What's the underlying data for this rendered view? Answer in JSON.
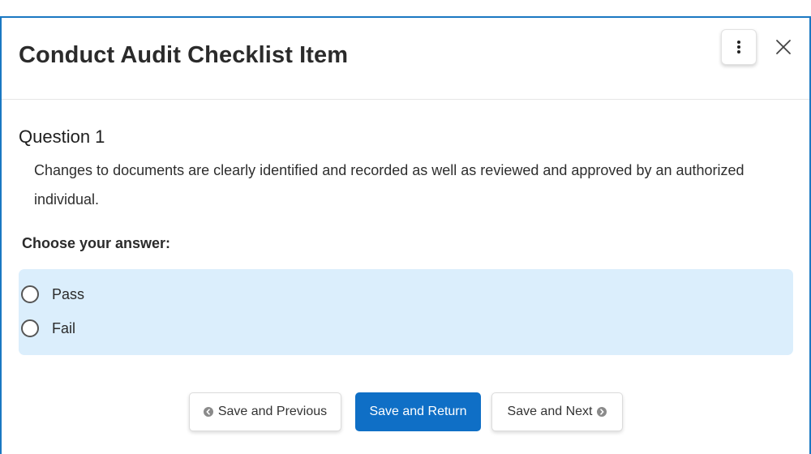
{
  "dialog": {
    "title": "Conduct Audit Checklist Item"
  },
  "header": {
    "menu_icon": "vertical-ellipsis-icon",
    "close_icon": "close-icon"
  },
  "question": {
    "heading": "Question 1",
    "text": "Changes to documents are clearly identified and recorded as well as reviewed and approved by an authorized individual."
  },
  "answer": {
    "prompt": "Choose your answer:",
    "options": [
      {
        "label": "Pass",
        "selected": false
      },
      {
        "label": "Fail",
        "selected": false
      }
    ]
  },
  "footer": {
    "previous_label": "Save and Previous",
    "return_label": "Save and Return",
    "next_label": "Save and Next"
  },
  "colors": {
    "accent": "#0f6fc6",
    "border": "#1a78c2",
    "options_background": "#dbeefc"
  }
}
